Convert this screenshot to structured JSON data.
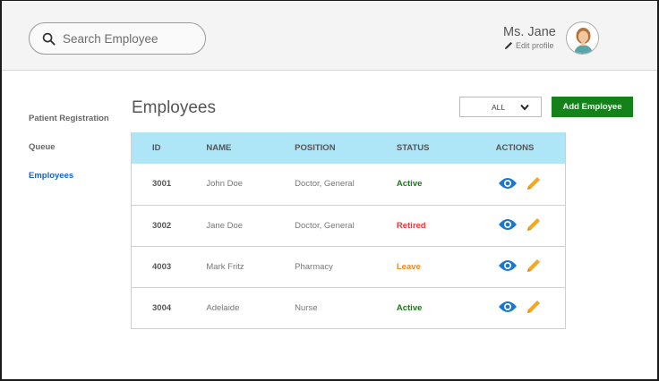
{
  "search": {
    "placeholder": "Search Employee"
  },
  "user": {
    "name": "Ms. Jane",
    "edit_label": "Edit profile"
  },
  "sidebar": {
    "items": [
      {
        "label": "Patient Registration",
        "active": false
      },
      {
        "label": "Queue",
        "active": false
      },
      {
        "label": "Employees",
        "active": true
      }
    ]
  },
  "main": {
    "title": "Employees",
    "filter": {
      "selected": "ALL"
    },
    "add_button": "Add Employee"
  },
  "table": {
    "headers": {
      "id": "ID",
      "name": "NAME",
      "position": "POSITION",
      "status": "STATUS",
      "actions": "ACTIONS"
    },
    "rows": [
      {
        "id": "3001",
        "name": "John Doe",
        "position": "Doctor, General",
        "status": "Active"
      },
      {
        "id": "3002",
        "name": "Jane Doe",
        "position": "Doctor, General",
        "status": "Retired"
      },
      {
        "id": "4003",
        "name": "Mark Fritz",
        "position": "Pharmacy",
        "status": "Leave"
      },
      {
        "id": "3004",
        "name": "Adelaide",
        "position": "Nurse",
        "status": "Active"
      }
    ]
  },
  "colors": {
    "accent_green": "#15811b",
    "header_blue": "#aee5f7",
    "status_active": "#1a7a1a",
    "status_retired": "#e53935",
    "status_leave": "#e88a2a",
    "view_icon": "#1976d2",
    "edit_icon": "#f5a623"
  },
  "icons": {
    "search": "search-icon",
    "edit_profile": "pencil-icon",
    "avatar": "avatar-icon",
    "view": "eye-icon",
    "edit": "pencil-icon",
    "dropdown": "chevron-down-icon"
  }
}
